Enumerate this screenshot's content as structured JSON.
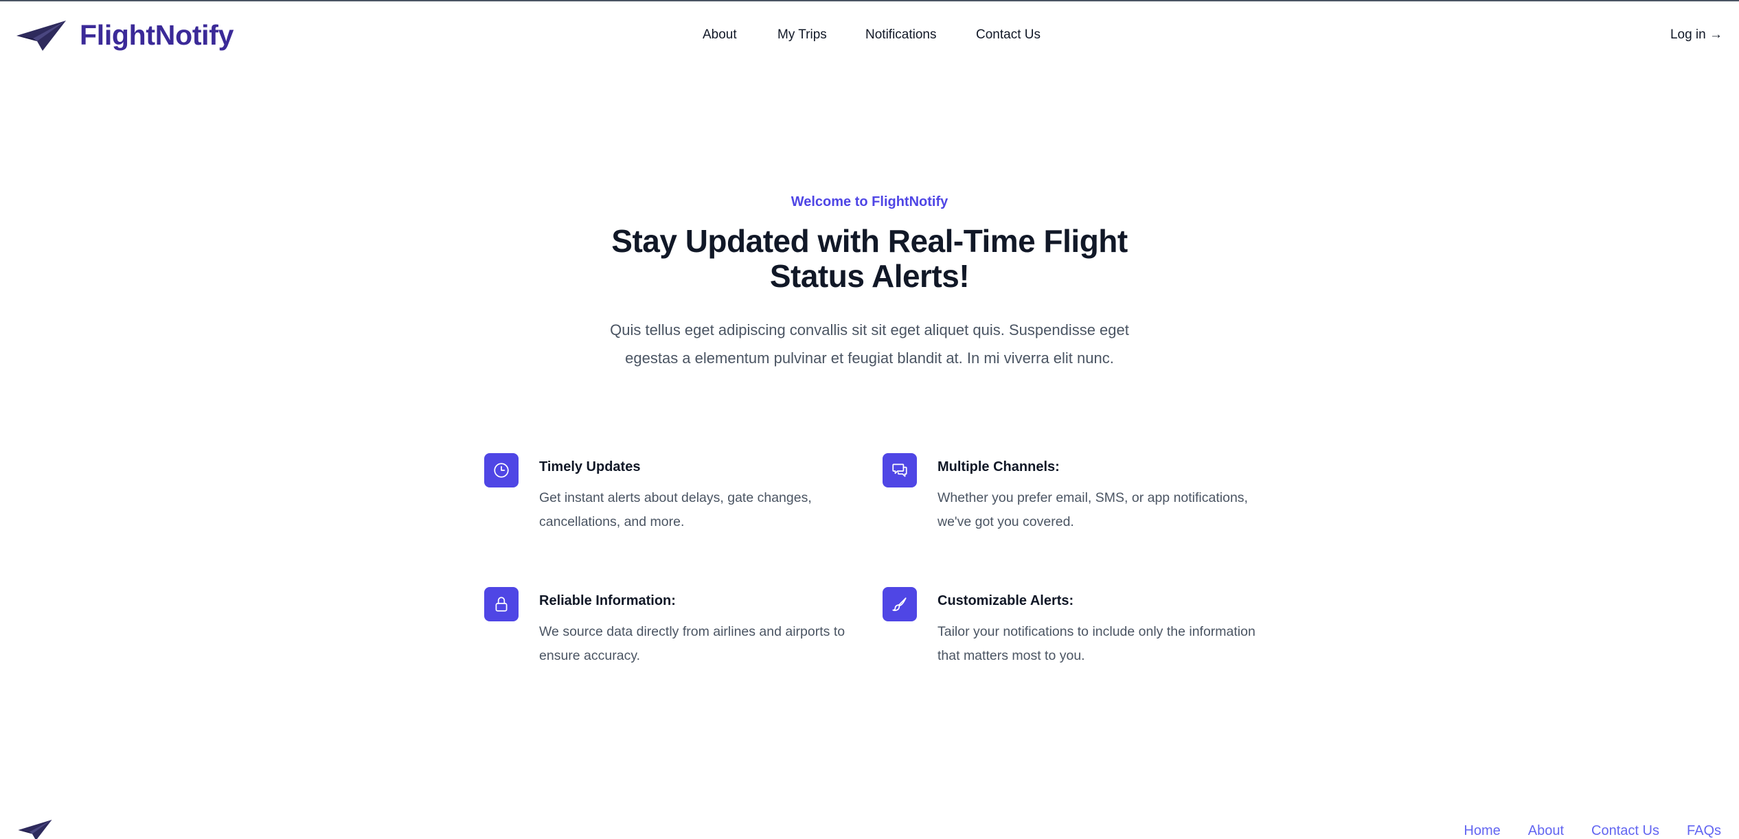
{
  "brand": {
    "name": "FlightNotify",
    "color": "#3b2a98",
    "logo_icon": "paper-plane-icon"
  },
  "nav": {
    "items": [
      {
        "label": "About"
      },
      {
        "label": "My Trips"
      },
      {
        "label": "Notifications"
      },
      {
        "label": "Contact Us"
      }
    ],
    "login_label": "Log in →"
  },
  "hero": {
    "eyebrow": "Welcome to FlightNotify",
    "title": "Stay Updated with Real-Time Flight Status Alerts!",
    "text": "Quis tellus eget adipiscing convallis sit sit eget aliquet quis. Suspendisse eget egestas a elementum pulvinar et feugiat blandit at. In mi viverra elit nunc."
  },
  "features": [
    {
      "icon": "clock-icon",
      "title": "Timely Updates",
      "text": "Get instant alerts about delays, gate changes, cancellations, and more."
    },
    {
      "icon": "chat-bubbles-icon",
      "title": "Multiple Channels:",
      "text": "Whether you prefer email, SMS, or app notifications, we've got you covered."
    },
    {
      "icon": "lock-icon",
      "title": "Reliable Information:",
      "text": "We source data directly from airlines and airports to ensure accuracy."
    },
    {
      "icon": "paint-brush-icon",
      "title": "Customizable Alerts:",
      "text": "Tailor your notifications to include only the information that matters most to you."
    }
  ],
  "footer": {
    "links": [
      {
        "label": "Home"
      },
      {
        "label": "About"
      },
      {
        "label": "Contact Us"
      },
      {
        "label": "FAQs"
      }
    ]
  },
  "colors": {
    "accent": "#4f46e5",
    "link": "#6366f1",
    "heading": "#111827",
    "body_text": "#4b5563"
  }
}
